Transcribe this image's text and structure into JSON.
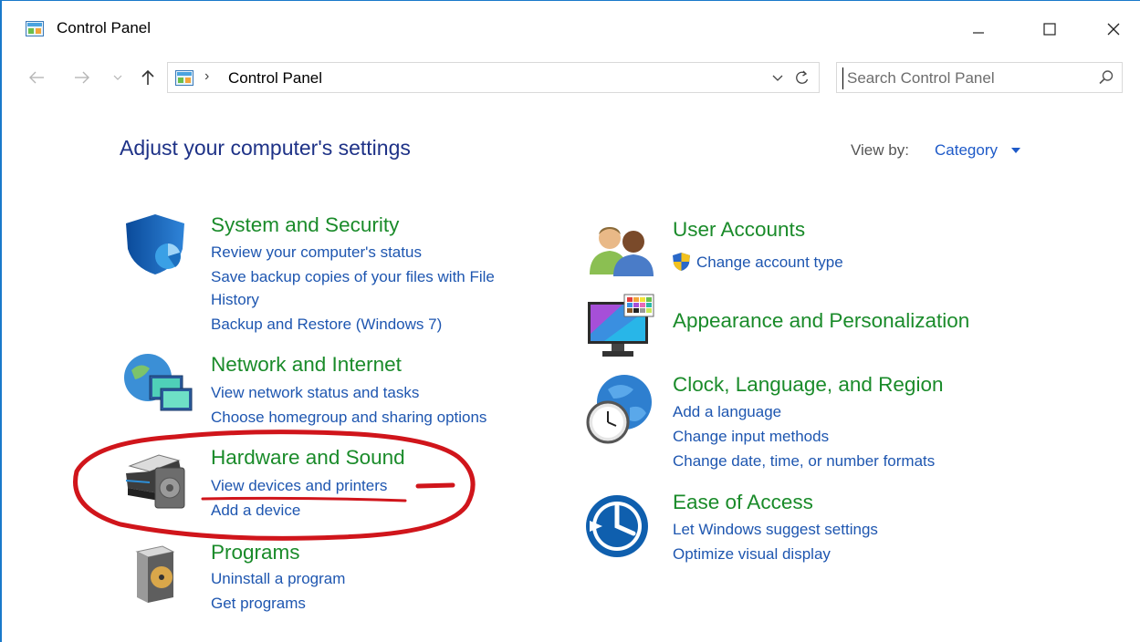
{
  "window": {
    "title": "Control Panel",
    "minimize_glyph": "—",
    "maximize_glyph": "☐",
    "close_glyph": "✕"
  },
  "address": {
    "separator": "›",
    "path": "Control Panel",
    "back_glyph": "←",
    "forward_glyph": "→"
  },
  "search": {
    "placeholder": "Search Control Panel",
    "value": ""
  },
  "header": {
    "title": "Adjust your computer's settings",
    "view_by_label": "View by:",
    "view_by_value": "Category"
  },
  "categories": {
    "system_security": {
      "title": "System and Security",
      "icon": "shield-icon",
      "links": [
        "Review your computer's status",
        "Save backup copies of your files with File",
        "History",
        "Backup and Restore (Windows 7)"
      ]
    },
    "network": {
      "title": "Network and Internet",
      "icon": "globe-network-icon",
      "links": [
        "View network status and tasks",
        "Choose homegroup and sharing options"
      ]
    },
    "hardware": {
      "title": "Hardware and Sound",
      "icon": "printer-speaker-icon",
      "links": [
        "View devices and printers",
        "Add a device"
      ]
    },
    "programs": {
      "title": "Programs",
      "icon": "programs-disc-icon",
      "links": [
        "Uninstall a program",
        "Get programs"
      ]
    },
    "user_accounts": {
      "title": "User Accounts",
      "icon": "users-icon",
      "links": [
        "Change account type"
      ]
    },
    "appearance": {
      "title": "Appearance and Personalization",
      "icon": "monitor-palette-icon",
      "links": []
    },
    "clock": {
      "title": "Clock, Language, and Region",
      "icon": "clock-globe-icon",
      "links": [
        "Add a language",
        "Change input methods",
        "Change date, time, or number formats"
      ]
    },
    "ease": {
      "title": "Ease of Access",
      "icon": "ease-of-access-icon",
      "links": [
        "Let Windows suggest settings",
        "Optimize visual display"
      ]
    }
  },
  "colors": {
    "category_title": "#1a8b2a",
    "link": "#1e56b0",
    "page_title": "#1e3287",
    "annotation": "#d0151b"
  }
}
